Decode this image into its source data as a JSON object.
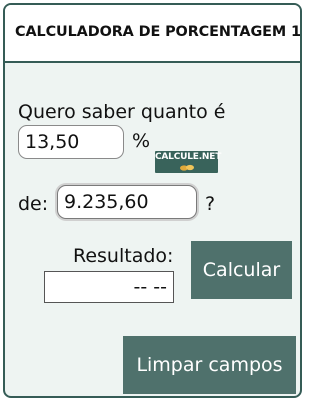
{
  "header": {
    "title": "CALCULADORA DE PORCENTAGEM 1"
  },
  "form": {
    "prompt": "Quero saber quanto é",
    "percent_value": "13,50",
    "percent_sign": "%",
    "of_label": "de:",
    "base_value": "9.235,60",
    "question_mark": "?",
    "result_label": "Resultado:",
    "result_value": "-- --"
  },
  "logo": {
    "text": "CALCULE.NET"
  },
  "buttons": {
    "calculate": "Calcular",
    "clear": "Limpar campos"
  },
  "colors": {
    "border": "#355c56",
    "button": "#4f716c",
    "panel_background": "#eef4f2"
  }
}
